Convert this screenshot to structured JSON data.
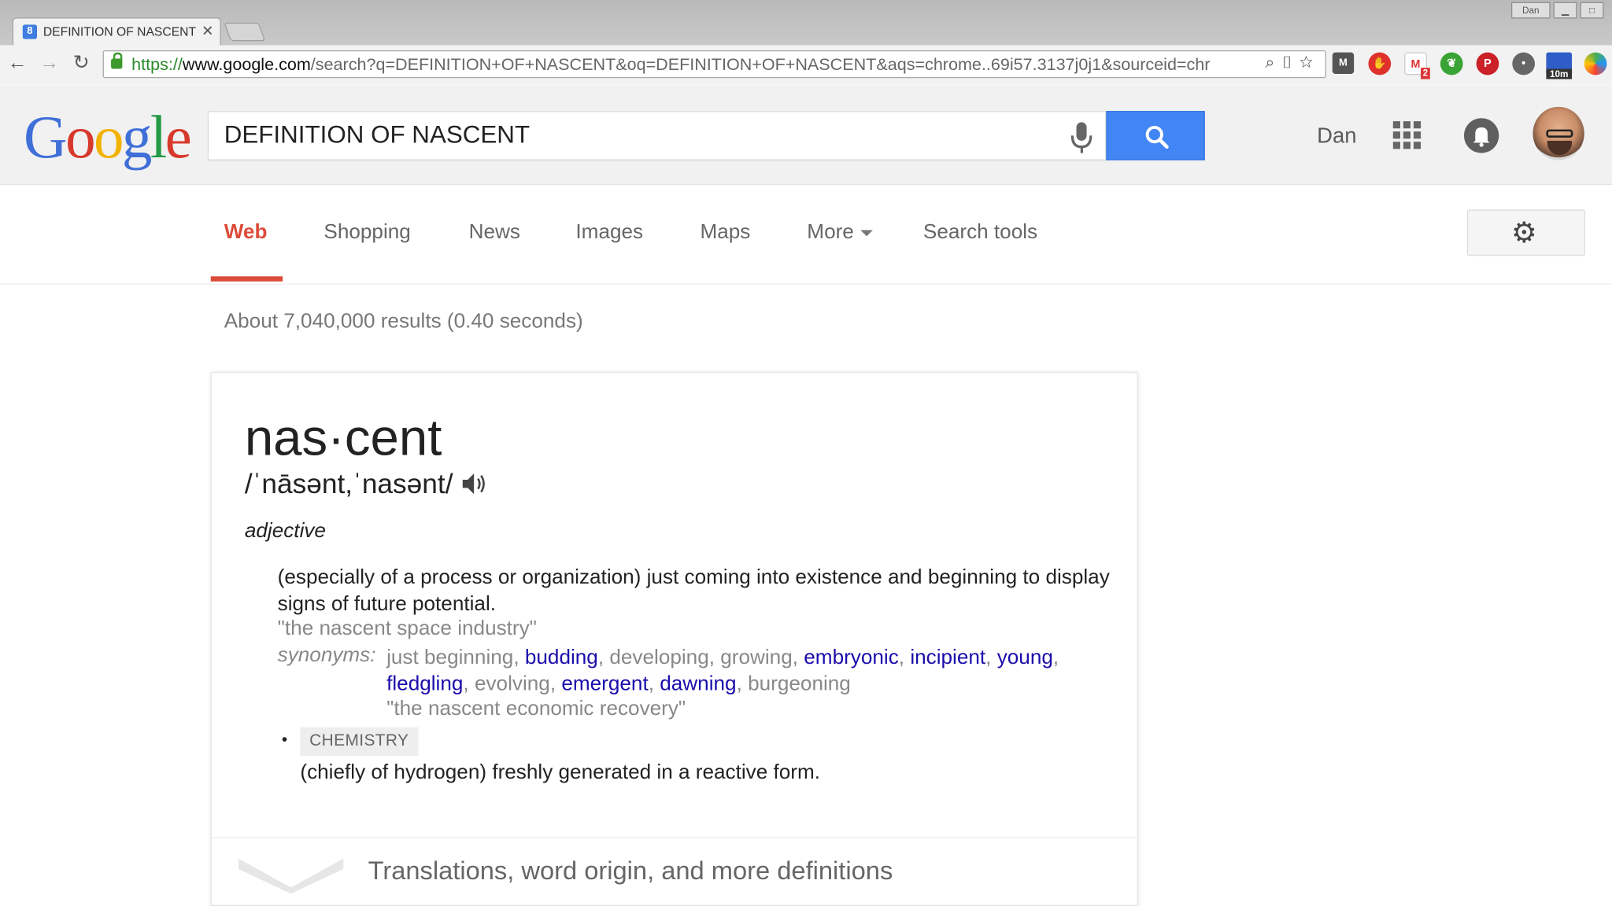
{
  "browser": {
    "tab_title": "DEFINITION OF NASCENT",
    "tab_favicon": "8",
    "window_user": "Dan",
    "url_scheme": "https://",
    "url_host": "www.google.com",
    "url_path": "/search?q=DEFINITION+OF+NASCENT&oq=DEFINITION+OF+NASCENT&aqs=chrome..69i57.3137j0j1&sourceid=chr",
    "extension_badges": {
      "gmail_count": "2",
      "timer": "10m"
    }
  },
  "header": {
    "logo": [
      "G",
      "o",
      "o",
      "g",
      "l",
      "e"
    ],
    "search_value": "DEFINITION OF NASCENT",
    "username": "Dan"
  },
  "nav": {
    "tabs": [
      "Web",
      "Shopping",
      "News",
      "Images",
      "Maps",
      "More",
      "Search tools"
    ],
    "active": "Web"
  },
  "results": {
    "stats": "About 7,040,000 results (0.40 seconds)"
  },
  "definition": {
    "word": "nas·cent",
    "pronunciation": "/ˈnāsənt,ˈnasənt/",
    "part_of_speech": "adjective",
    "sense1": {
      "text": "(especially of a process or organization) just coming into existence and beginning to display signs of future potential.",
      "example": "\"the nascent space industry\"",
      "synonyms_label": "synonyms:",
      "synonyms": [
        {
          "word": "just beginning",
          "link": false
        },
        {
          "word": "budding",
          "link": true
        },
        {
          "word": "developing",
          "link": false
        },
        {
          "word": "growing",
          "link": false
        },
        {
          "word": "embryonic",
          "link": true
        },
        {
          "word": "incipient",
          "link": true
        },
        {
          "word": "young",
          "link": true
        },
        {
          "word": "fledgling",
          "link": true
        },
        {
          "word": "evolving",
          "link": false
        },
        {
          "word": "emergent",
          "link": true
        },
        {
          "word": "dawning",
          "link": true
        },
        {
          "word": "burgeoning",
          "link": false
        }
      ],
      "synonym_example": "\"the nascent economic recovery\""
    },
    "sense2": {
      "domain": "CHEMISTRY",
      "text": "(chiefly of hydrogen) freshly generated in a reactive form."
    },
    "more_link": "Translations, word origin, and more definitions"
  },
  "colors": {
    "accent_red": "#dd4b39",
    "link_blue": "#1a0dab",
    "search_blue": "#4285f4"
  },
  "icons": [
    "back-icon",
    "forward-icon",
    "reload-icon",
    "lock-icon",
    "zoom-icon",
    "page-action-icon",
    "star-icon",
    "mic-icon",
    "search-icon",
    "apps-grid-icon",
    "bell-icon",
    "gear-icon",
    "speaker-icon",
    "chevron-down-icon"
  ]
}
